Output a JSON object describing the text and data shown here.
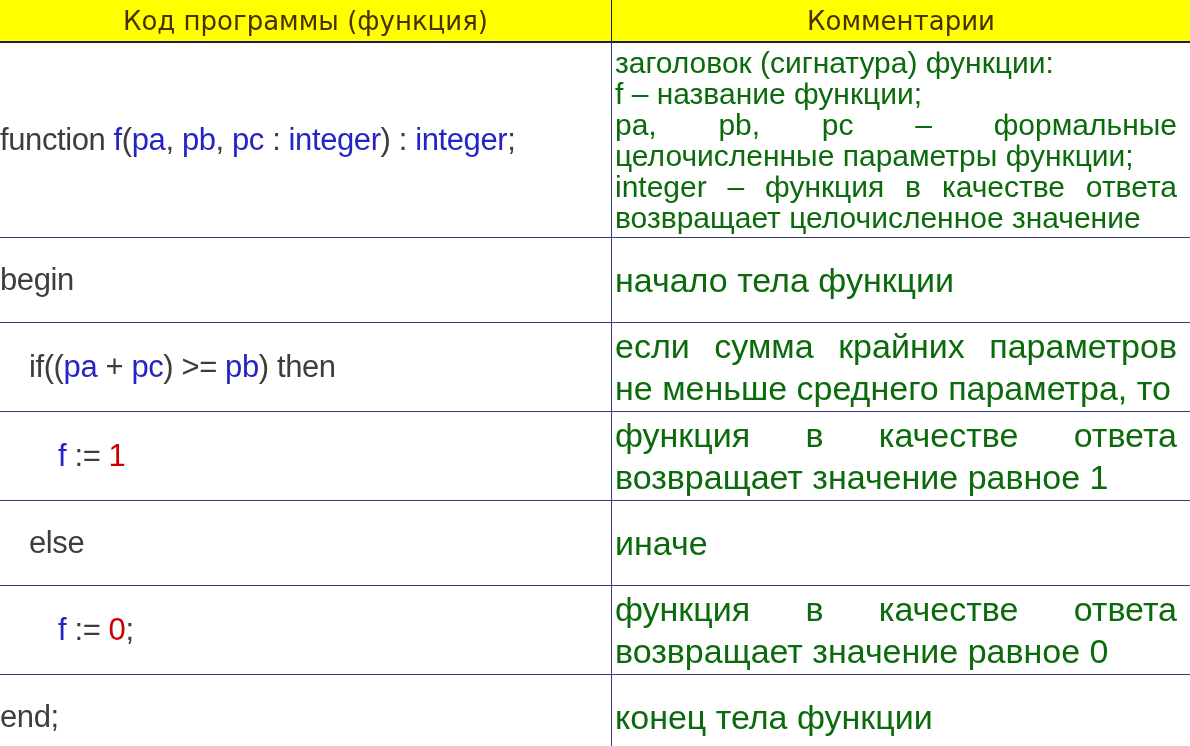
{
  "table": {
    "columns": [
      "Код программы (функция)",
      "Комментарии"
    ],
    "rows": [
      {
        "code": [
          {
            "text": "function ",
            "kind": "plain"
          },
          {
            "text": "f",
            "kind": "name"
          },
          {
            "text": "(",
            "kind": "plain"
          },
          {
            "text": "pa",
            "kind": "name"
          },
          {
            "text": ", ",
            "kind": "plain"
          },
          {
            "text": "pb",
            "kind": "name"
          },
          {
            "text": ", ",
            "kind": "plain"
          },
          {
            "text": "pc",
            "kind": "name"
          },
          {
            "text": " : ",
            "kind": "plain"
          },
          {
            "text": "integer",
            "kind": "name"
          },
          {
            "text": ") : ",
            "kind": "plain"
          },
          {
            "text": "integer",
            "kind": "name"
          },
          {
            "text": ";",
            "kind": "plain"
          }
        ],
        "comment": [
          "заголовок (сигнатура) функции:",
          "f – название функции;",
          "pa, pb, pc – формальные целочисленные параметры функции;",
          "integer – функция в качестве ответа возвращает целочисленное значение"
        ]
      },
      {
        "code": [
          {
            "text": "begin",
            "kind": "plain"
          }
        ],
        "comment": [
          "начало тела функции"
        ],
        "children": [
          {
            "code": [
              {
                "text": "if((",
                "kind": "plain"
              },
              {
                "text": "pa",
                "kind": "name"
              },
              {
                "text": " + ",
                "kind": "plain"
              },
              {
                "text": "pc",
                "kind": "name"
              },
              {
                "text": ") >= ",
                "kind": "plain"
              },
              {
                "text": "pb",
                "kind": "name"
              },
              {
                "text": ") then",
                "kind": "plain"
              }
            ],
            "comment": [
              "если сумма крайних параметров не меньше среднего параметра, то"
            ],
            "children": [
              {
                "code": [
                  {
                    "text": "f",
                    "kind": "name"
                  },
                  {
                    "text": " := ",
                    "kind": "plain"
                  },
                  {
                    "text": "1",
                    "kind": "number"
                  }
                ],
                "comment": [
                  "функция в качестве ответа возвращает значение равное 1"
                ]
              }
            ]
          },
          {
            "code": [
              {
                "text": "else",
                "kind": "plain"
              }
            ],
            "comment": [
              "иначе"
            ],
            "children": [
              {
                "code": [
                  {
                    "text": "f",
                    "kind": "name"
                  },
                  {
                    "text": " := ",
                    "kind": "plain"
                  },
                  {
                    "text": "0",
                    "kind": "number"
                  },
                  {
                    "text": ";",
                    "kind": "plain"
                  }
                ],
                "comment": [
                  "функция в качестве ответа возвращает значение равное 0"
                ]
              }
            ]
          }
        ]
      },
      {
        "code": [
          {
            "text": "end;",
            "kind": "plain"
          }
        ],
        "comment": [
          "конец тела функции"
        ]
      }
    ]
  }
}
